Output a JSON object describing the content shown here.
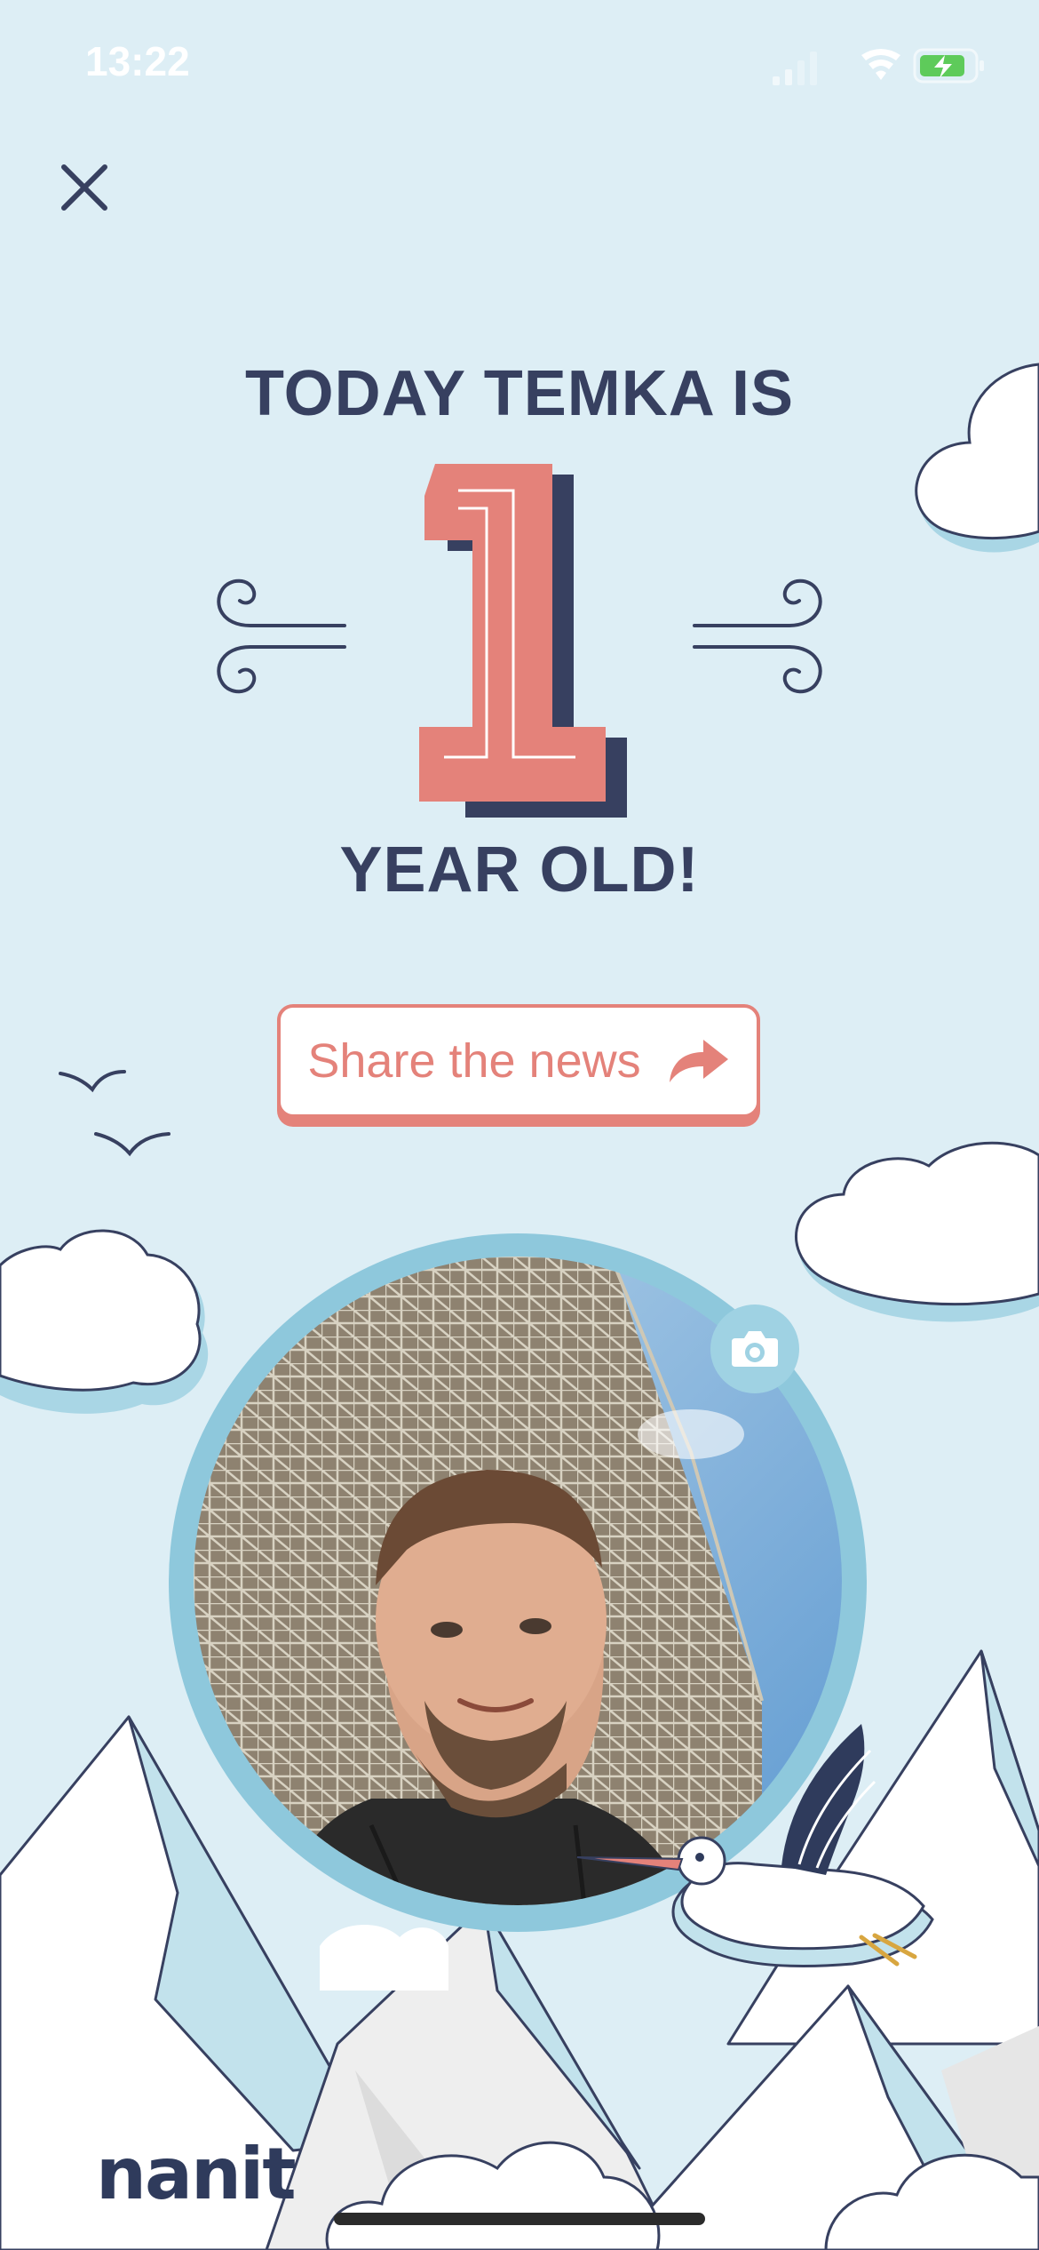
{
  "status_bar": {
    "time": "13:22",
    "icons": [
      "cellular-signal-icon",
      "wifi-icon",
      "battery-charging-icon"
    ]
  },
  "close": {
    "icon": "close-icon"
  },
  "milestone": {
    "line1": "TODAY TEMKA IS",
    "age": "1",
    "line2": "YEAR OLD!"
  },
  "share": {
    "label": "Share the news",
    "icon": "share-arrow-icon"
  },
  "photo": {
    "camera_icon": "camera-icon"
  },
  "brand": {
    "logo": "nanit"
  },
  "colors": {
    "background": "#ddeef5",
    "text": "#374060",
    "accent": "#e4827a",
    "frame": "#8ec8dc"
  }
}
